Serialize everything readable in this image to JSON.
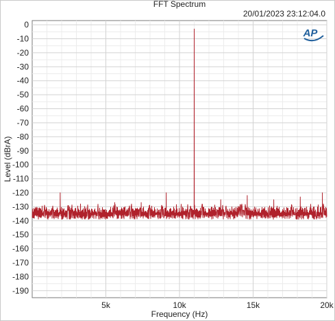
{
  "chart_data": {
    "type": "line",
    "title": "FFT Spectrum",
    "timestamp": "20/01/2023 23:12:04.0",
    "logo": "AP",
    "xlabel": "Frequency (Hz)",
    "ylabel": "Level (dBrA)",
    "xlim": [
      0,
      20000
    ],
    "ylim": [
      -195,
      3
    ],
    "x_ticks": [
      {
        "value": 5000,
        "label": "5k"
      },
      {
        "value": 10000,
        "label": "10k"
      },
      {
        "value": 15000,
        "label": "15k"
      },
      {
        "value": 20000,
        "label": "20k"
      }
    ],
    "y_ticks": [
      0,
      -10,
      -20,
      -30,
      -40,
      -50,
      -60,
      -70,
      -80,
      -90,
      -100,
      -110,
      -120,
      -130,
      -140,
      -150,
      -160,
      -170,
      -180,
      -190
    ],
    "grid": true,
    "series_color": "#b0222c",
    "noise_floor": {
      "mean": -135,
      "min": -139,
      "max": -130
    },
    "peaks": [
      {
        "x": 11000,
        "y": -3
      },
      {
        "x": 1900,
        "y": -120
      },
      {
        "x": 5600,
        "y": -127
      },
      {
        "x": 7400,
        "y": -127
      },
      {
        "x": 9100,
        "y": -120
      },
      {
        "x": 12800,
        "y": -125
      },
      {
        "x": 14600,
        "y": -122
      },
      {
        "x": 16400,
        "y": -125
      },
      {
        "x": 18200,
        "y": -123
      },
      {
        "x": 19700,
        "y": -120
      }
    ]
  }
}
